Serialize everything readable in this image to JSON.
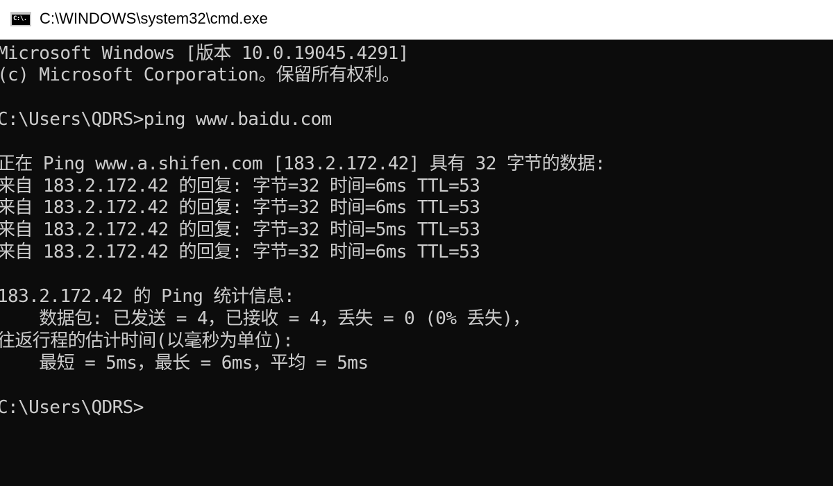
{
  "window": {
    "title": "C:\\WINDOWS\\system32\\cmd.exe",
    "icon": "cmd-icon",
    "icon_label": "C:\\."
  },
  "console": {
    "background": "#0c0c0c",
    "foreground": "#cccccc",
    "lines": [
      "Microsoft Windows [版本 10.0.19045.4291]",
      "(c) Microsoft Corporation。保留所有权利。",
      "",
      "C:\\Users\\QDRS>ping www.baidu.com",
      "",
      "正在 Ping www.a.shifen.com [183.2.172.42] 具有 32 字节的数据:",
      "来自 183.2.172.42 的回复: 字节=32 时间=6ms TTL=53",
      "来自 183.2.172.42 的回复: 字节=32 时间=6ms TTL=53",
      "来自 183.2.172.42 的回复: 字节=32 时间=5ms TTL=53",
      "来自 183.2.172.42 的回复: 字节=32 时间=6ms TTL=53",
      "",
      "183.2.172.42 的 Ping 统计信息:",
      "    数据包: 已发送 = 4，已接收 = 4，丢失 = 0 (0% 丢失)，",
      "往返行程的估计时间(以毫秒为单位):",
      "    最短 = 5ms，最长 = 6ms，平均 = 5ms",
      "",
      "C:\\Users\\QDRS>"
    ]
  }
}
